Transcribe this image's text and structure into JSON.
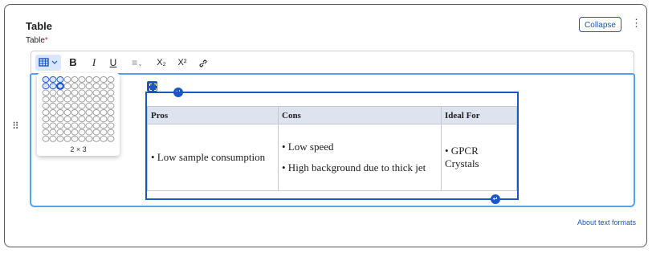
{
  "header": {
    "title": "Table",
    "field_label": "Table",
    "required_marker": "*",
    "collapse_label": "Collapse",
    "more_icon": "⋮"
  },
  "toolbar": {
    "table_icon": "table-icon",
    "bold": "B",
    "italic": "I",
    "underline": "U",
    "align_icon": "≡",
    "subscript": "X₂",
    "superscript": "X²",
    "link_icon": "🔗"
  },
  "grid_picker": {
    "size_label": "2 × 3",
    "rows_selected": 2,
    "cols_selected": 3
  },
  "table": {
    "headers": [
      "Pros",
      "Cons",
      "Ideal For"
    ],
    "rows": [
      {
        "pros": [
          "• Low sample consumption"
        ],
        "cons": [
          "• Low speed",
          "• High background due to thick jet"
        ],
        "ideal": [
          "• GPCR Crystals"
        ]
      }
    ]
  },
  "footer": {
    "about_link": "About text formats"
  },
  "colors": {
    "accent": "#1a56c4",
    "focus_border": "#58a0ea",
    "header_bg": "#dde3ef"
  }
}
